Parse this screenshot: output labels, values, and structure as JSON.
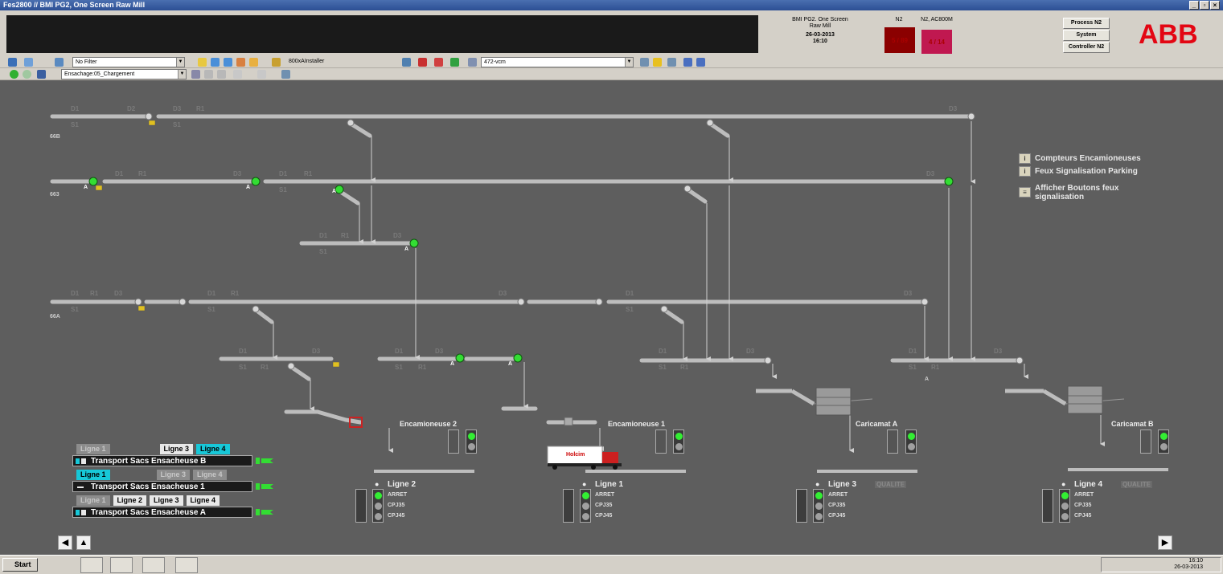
{
  "window": {
    "title": "Fes2800 // BMI PG2, One Screen Raw Mill"
  },
  "header": {
    "info_title": "BMI PG2. One Screen Raw Mill",
    "date": "26-03-2013",
    "time": "16:10",
    "col1_label": "N2",
    "col2_label": "N2, AC800M",
    "alarm1": "5 / 89",
    "alarm2": "4 / 14",
    "alarm1_color": "#8b0000",
    "alarm2_color": "#c01850",
    "buttons": [
      "Process N2",
      "System",
      "Controller N2"
    ],
    "logo": "ABB"
  },
  "toolbar": {
    "filter": "No Filter",
    "installer": "800xAInstaller",
    "search": "472-vcm",
    "breadcrumb": "Ensachage:05_Chargement"
  },
  "diagram": {
    "lines": [
      "66B",
      "663",
      "66A"
    ],
    "labels": {
      "d1": "D1",
      "d2": "D2",
      "d3": "D3",
      "r1": "R1",
      "s1": "S1",
      "a": "A"
    },
    "legend": [
      {
        "icon": "i",
        "text": "Compteurs Encamioneuses"
      },
      {
        "icon": "i",
        "text": "Feux Signalisation Parking"
      },
      {
        "icon": "≡",
        "text": "Afficher Boutons feux signalisation"
      }
    ],
    "stations": [
      "Encamioneuse 2",
      "Encamioneuse 1",
      "Caricamat A",
      "Caricamat B"
    ],
    "truck_brand": "Holcim"
  },
  "controls": {
    "row1_buttons": [
      "Ligne 1",
      "Ligne 3",
      "Ligne 4"
    ],
    "row2_buttons": [
      "Ligne 1",
      "Ligne 3",
      "Ligne 4"
    ],
    "row3_buttons": [
      "Ligne 1",
      "Ligne 2",
      "Ligne 3",
      "Ligne 4"
    ],
    "transports": [
      "Transport Sacs Ensacheuse B",
      "Transport Sacs Ensacheuse 1",
      "Transport Sacs Ensacheuse A"
    ]
  },
  "lines_panel": [
    {
      "name": "Ligne 2",
      "opts": [
        "ARRET",
        "CPJ35",
        "CPJ45"
      ],
      "qualite": ""
    },
    {
      "name": "Ligne 1",
      "opts": [
        "ARRET",
        "CPJ35",
        "CPJ45"
      ],
      "qualite": ""
    },
    {
      "name": "Ligne 3",
      "opts": [
        "ARRET",
        "CPJ35",
        "CPJ45"
      ],
      "qualite": "QUALITE"
    },
    {
      "name": "Ligne 4",
      "opts": [
        "ARRET",
        "CPJ35",
        "CPJ45"
      ],
      "qualite": "QUALITE"
    }
  ],
  "taskbar": {
    "start": "Start",
    "clock_time": "16:10",
    "clock_date": "26-03-2013"
  }
}
